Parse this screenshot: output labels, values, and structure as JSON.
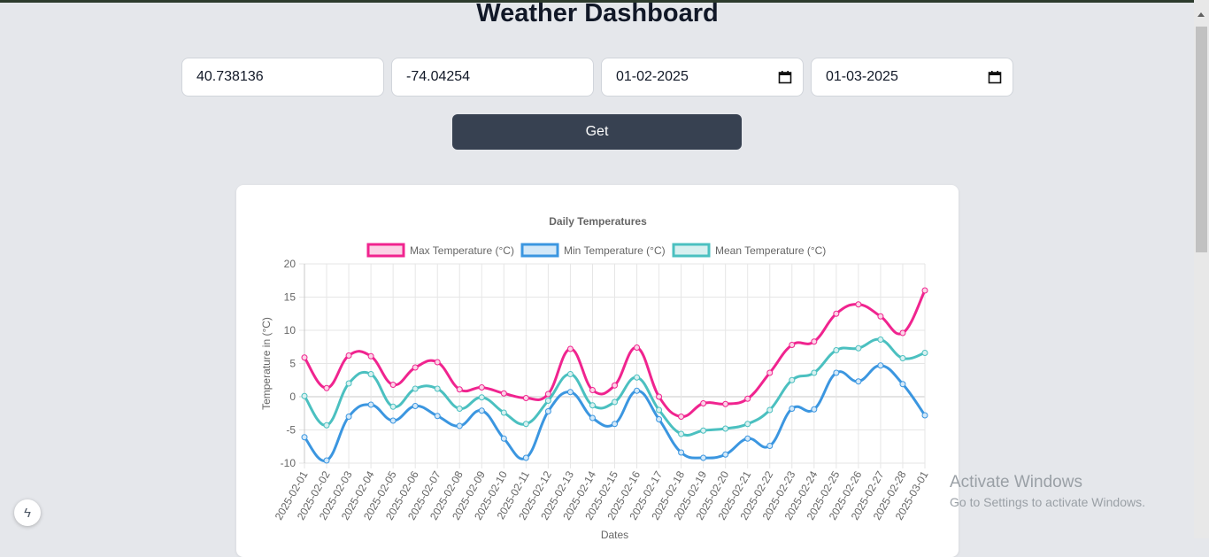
{
  "page": {
    "title": "Weather Dashboard"
  },
  "form": {
    "latitude": "40.738136",
    "longitude": "-74.04254",
    "start_date": "01-02-2025",
    "end_date": "01-03-2025",
    "submit_label": "Get"
  },
  "chart_data": {
    "type": "line",
    "title": "Daily Temperatures",
    "xlabel": "Dates",
    "ylabel": "Temperature in (°C)",
    "ylim": [
      -10,
      20
    ],
    "yticks": [
      20,
      15,
      10,
      5,
      0,
      -5,
      -10
    ],
    "grid": true,
    "legend_position": "top",
    "x": [
      "2025-02-01",
      "2025-02-02",
      "2025-02-03",
      "2025-02-04",
      "2025-02-05",
      "2025-02-06",
      "2025-02-07",
      "2025-02-08",
      "2025-02-09",
      "2025-02-10",
      "2025-02-11",
      "2025-02-12",
      "2025-02-13",
      "2025-02-14",
      "2025-02-15",
      "2025-02-16",
      "2025-02-17",
      "2025-02-18",
      "2025-02-19",
      "2025-02-20",
      "2025-02-21",
      "2025-02-22",
      "2025-02-23",
      "2025-02-24",
      "2025-02-25",
      "2025-02-26",
      "2025-02-27",
      "2025-02-28",
      "2025-03-01"
    ],
    "series": [
      {
        "name": "Max Temperature (°C)",
        "color": "#f0248f",
        "fill": "#fbd3e6",
        "values": [
          5.9,
          1.3,
          6.2,
          6.1,
          1.8,
          4.4,
          5.2,
          1.1,
          1.4,
          0.5,
          -0.2,
          0.4,
          7.2,
          1.0,
          1.7,
          7.4,
          0.0,
          -3.0,
          -1.0,
          -1.1,
          -0.3,
          3.6,
          7.8,
          8.3,
          12.5,
          13.9,
          12.1,
          9.6,
          16.0
        ]
      },
      {
        "name": "Min Temperature (°C)",
        "color": "#3b96e0",
        "fill": "#d3e8f8",
        "values": [
          -6.1,
          -9.6,
          -3.0,
          -1.2,
          -3.6,
          -1.4,
          -2.9,
          -4.4,
          -2.1,
          -6.3,
          -9.2,
          -2.2,
          0.7,
          -3.2,
          -4.1,
          0.9,
          -3.4,
          -8.4,
          -9.2,
          -8.7,
          -6.3,
          -7.4,
          -1.8,
          -1.9,
          3.6,
          2.3,
          4.7,
          1.9,
          -2.8
        ]
      },
      {
        "name": "Mean Temperature (°C)",
        "color": "#4bc0c0",
        "fill": "#d8f0f0",
        "values": [
          0.1,
          -4.3,
          2.0,
          3.4,
          -1.5,
          1.2,
          1.2,
          -1.8,
          -0.1,
          -2.4,
          -4.1,
          -0.6,
          3.4,
          -1.3,
          -0.8,
          2.9,
          -2.0,
          -5.6,
          -5.1,
          -4.8,
          -4.1,
          -2.0,
          2.5,
          3.6,
          7.0,
          7.3,
          8.6,
          5.8,
          6.6
        ]
      }
    ]
  },
  "overlay": {
    "activate_title": "Activate Windows",
    "activate_subtitle": "Go to Settings to activate Windows."
  },
  "icons": {
    "calendar": "calendar-icon",
    "floating": "bolt-icon"
  }
}
